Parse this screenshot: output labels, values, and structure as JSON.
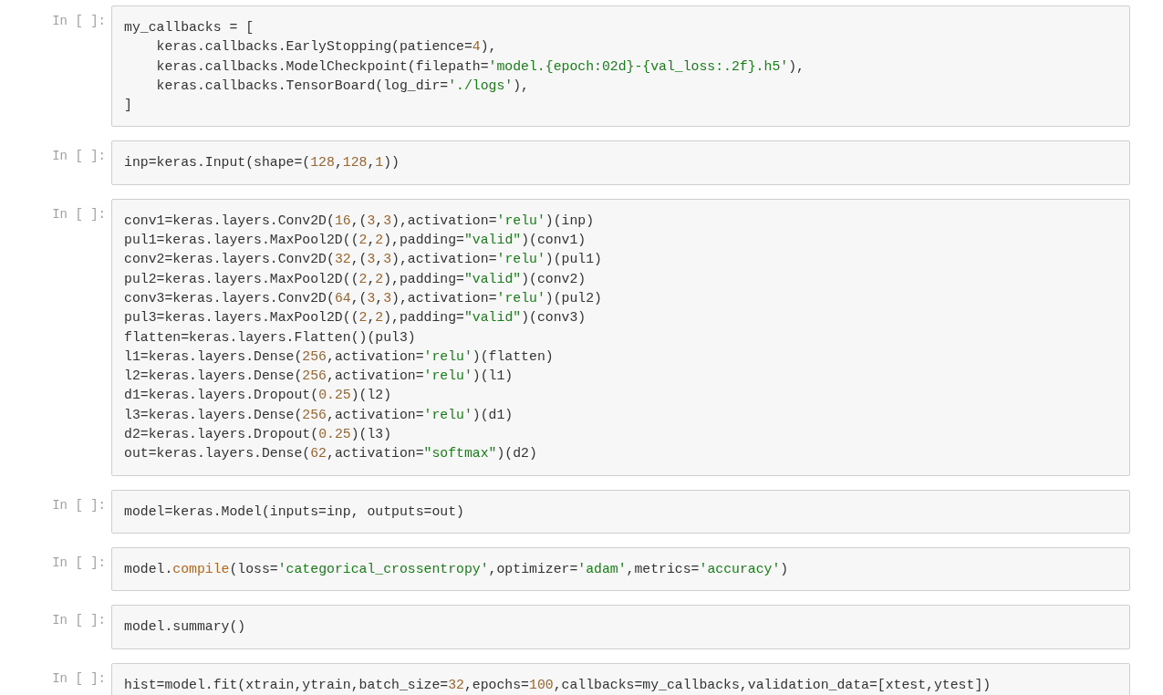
{
  "cells": [
    {
      "prompt": "In [ ]:",
      "lines": [
        [
          {
            "text": "my_callbacks = [",
            "kind": "plain"
          }
        ],
        [
          {
            "text": "    keras.callbacks.EarlyStopping(patience=",
            "kind": "plain"
          },
          {
            "text": "4",
            "kind": "number"
          },
          {
            "text": "),",
            "kind": "plain"
          }
        ],
        [
          {
            "text": "    keras.callbacks.ModelCheckpoint(filepath=",
            "kind": "plain"
          },
          {
            "text": "'model.{epoch:02d}-{val_loss:.2f}.h5'",
            "kind": "string"
          },
          {
            "text": "),",
            "kind": "plain"
          }
        ],
        [
          {
            "text": "    keras.callbacks.TensorBoard(log_dir=",
            "kind": "plain"
          },
          {
            "text": "'./logs'",
            "kind": "string"
          },
          {
            "text": "),",
            "kind": "plain"
          }
        ],
        [
          {
            "text": "]",
            "kind": "plain"
          }
        ]
      ]
    },
    {
      "prompt": "In [ ]:",
      "lines": [
        [
          {
            "text": "inp=keras.Input(shape=(",
            "kind": "plain"
          },
          {
            "text": "128",
            "kind": "number"
          },
          {
            "text": ",",
            "kind": "plain"
          },
          {
            "text": "128",
            "kind": "number"
          },
          {
            "text": ",",
            "kind": "plain"
          },
          {
            "text": "1",
            "kind": "number"
          },
          {
            "text": "))",
            "kind": "plain"
          }
        ]
      ]
    },
    {
      "prompt": "In [ ]:",
      "lines": [
        [
          {
            "text": "conv1=keras.layers.Conv2D(",
            "kind": "plain"
          },
          {
            "text": "16",
            "kind": "number"
          },
          {
            "text": ",(",
            "kind": "plain"
          },
          {
            "text": "3",
            "kind": "number"
          },
          {
            "text": ",",
            "kind": "plain"
          },
          {
            "text": "3",
            "kind": "number"
          },
          {
            "text": "),activation=",
            "kind": "plain"
          },
          {
            "text": "'relu'",
            "kind": "string"
          },
          {
            "text": ")(inp)",
            "kind": "plain"
          }
        ],
        [
          {
            "text": "pul1=keras.layers.MaxPool2D((",
            "kind": "plain"
          },
          {
            "text": "2",
            "kind": "number"
          },
          {
            "text": ",",
            "kind": "plain"
          },
          {
            "text": "2",
            "kind": "number"
          },
          {
            "text": "),padding=",
            "kind": "plain"
          },
          {
            "text": "\"valid\"",
            "kind": "string"
          },
          {
            "text": ")(conv1)",
            "kind": "plain"
          }
        ],
        [
          {
            "text": "conv2=keras.layers.Conv2D(",
            "kind": "plain"
          },
          {
            "text": "32",
            "kind": "number"
          },
          {
            "text": ",(",
            "kind": "plain"
          },
          {
            "text": "3",
            "kind": "number"
          },
          {
            "text": ",",
            "kind": "plain"
          },
          {
            "text": "3",
            "kind": "number"
          },
          {
            "text": "),activation=",
            "kind": "plain"
          },
          {
            "text": "'relu'",
            "kind": "string"
          },
          {
            "text": ")(pul1)",
            "kind": "plain"
          }
        ],
        [
          {
            "text": "pul2=keras.layers.MaxPool2D((",
            "kind": "plain"
          },
          {
            "text": "2",
            "kind": "number"
          },
          {
            "text": ",",
            "kind": "plain"
          },
          {
            "text": "2",
            "kind": "number"
          },
          {
            "text": "),padding=",
            "kind": "plain"
          },
          {
            "text": "\"valid\"",
            "kind": "string"
          },
          {
            "text": ")(conv2)",
            "kind": "plain"
          }
        ],
        [
          {
            "text": "conv3=keras.layers.Conv2D(",
            "kind": "plain"
          },
          {
            "text": "64",
            "kind": "number"
          },
          {
            "text": ",(",
            "kind": "plain"
          },
          {
            "text": "3",
            "kind": "number"
          },
          {
            "text": ",",
            "kind": "plain"
          },
          {
            "text": "3",
            "kind": "number"
          },
          {
            "text": "),activation=",
            "kind": "plain"
          },
          {
            "text": "'relu'",
            "kind": "string"
          },
          {
            "text": ")(pul2)",
            "kind": "plain"
          }
        ],
        [
          {
            "text": "pul3=keras.layers.MaxPool2D((",
            "kind": "plain"
          },
          {
            "text": "2",
            "kind": "number"
          },
          {
            "text": ",",
            "kind": "plain"
          },
          {
            "text": "2",
            "kind": "number"
          },
          {
            "text": "),padding=",
            "kind": "plain"
          },
          {
            "text": "\"valid\"",
            "kind": "string"
          },
          {
            "text": ")(conv3)",
            "kind": "plain"
          }
        ],
        [
          {
            "text": "flatten=keras.layers.Flatten()(pul3)",
            "kind": "plain"
          }
        ],
        [
          {
            "text": "l1=keras.layers.Dense(",
            "kind": "plain"
          },
          {
            "text": "256",
            "kind": "number"
          },
          {
            "text": ",activation=",
            "kind": "plain"
          },
          {
            "text": "'relu'",
            "kind": "string"
          },
          {
            "text": ")(flatten)",
            "kind": "plain"
          }
        ],
        [
          {
            "text": "l2=keras.layers.Dense(",
            "kind": "plain"
          },
          {
            "text": "256",
            "kind": "number"
          },
          {
            "text": ",activation=",
            "kind": "plain"
          },
          {
            "text": "'relu'",
            "kind": "string"
          },
          {
            "text": ")(l1)",
            "kind": "plain"
          }
        ],
        [
          {
            "text": "d1=keras.layers.Dropout(",
            "kind": "plain"
          },
          {
            "text": "0.25",
            "kind": "number"
          },
          {
            "text": ")(l2)",
            "kind": "plain"
          }
        ],
        [
          {
            "text": "l3=keras.layers.Dense(",
            "kind": "plain"
          },
          {
            "text": "256",
            "kind": "number"
          },
          {
            "text": ",activation=",
            "kind": "plain"
          },
          {
            "text": "'relu'",
            "kind": "string"
          },
          {
            "text": ")(d1)",
            "kind": "plain"
          }
        ],
        [
          {
            "text": "d2=keras.layers.Dropout(",
            "kind": "plain"
          },
          {
            "text": "0.25",
            "kind": "number"
          },
          {
            "text": ")(l3)",
            "kind": "plain"
          }
        ],
        [
          {
            "text": "out=keras.layers.Dense(",
            "kind": "plain"
          },
          {
            "text": "62",
            "kind": "number"
          },
          {
            "text": ",activation=",
            "kind": "plain"
          },
          {
            "text": "\"softmax\"",
            "kind": "string"
          },
          {
            "text": ")(d2)",
            "kind": "plain"
          }
        ]
      ]
    },
    {
      "prompt": "In [ ]:",
      "lines": [
        [
          {
            "text": "model=keras.Model(inputs=inp, outputs=out)",
            "kind": "plain"
          }
        ]
      ]
    },
    {
      "prompt": "In [ ]:",
      "lines": [
        [
          {
            "text": "model.",
            "kind": "plain"
          },
          {
            "text": "compile",
            "kind": "builtin"
          },
          {
            "text": "(loss=",
            "kind": "plain"
          },
          {
            "text": "'categorical_crossentropy'",
            "kind": "string"
          },
          {
            "text": ",optimizer=",
            "kind": "plain"
          },
          {
            "text": "'adam'",
            "kind": "string"
          },
          {
            "text": ",metrics=",
            "kind": "plain"
          },
          {
            "text": "'accuracy'",
            "kind": "string"
          },
          {
            "text": ")",
            "kind": "plain"
          }
        ]
      ]
    },
    {
      "prompt": "In [ ]:",
      "lines": [
        [
          {
            "text": "model.summary()",
            "kind": "plain"
          }
        ]
      ]
    },
    {
      "prompt": "In [ ]:",
      "lines": [
        [
          {
            "text": "hist=model.fit(xtrain,ytrain,batch_size=",
            "kind": "plain"
          },
          {
            "text": "32",
            "kind": "number"
          },
          {
            "text": ",epochs=",
            "kind": "plain"
          },
          {
            "text": "100",
            "kind": "number"
          },
          {
            "text": ",callbacks=my_callbacks,validation_data=[xtest,ytest])",
            "kind": "plain"
          }
        ]
      ]
    }
  ]
}
